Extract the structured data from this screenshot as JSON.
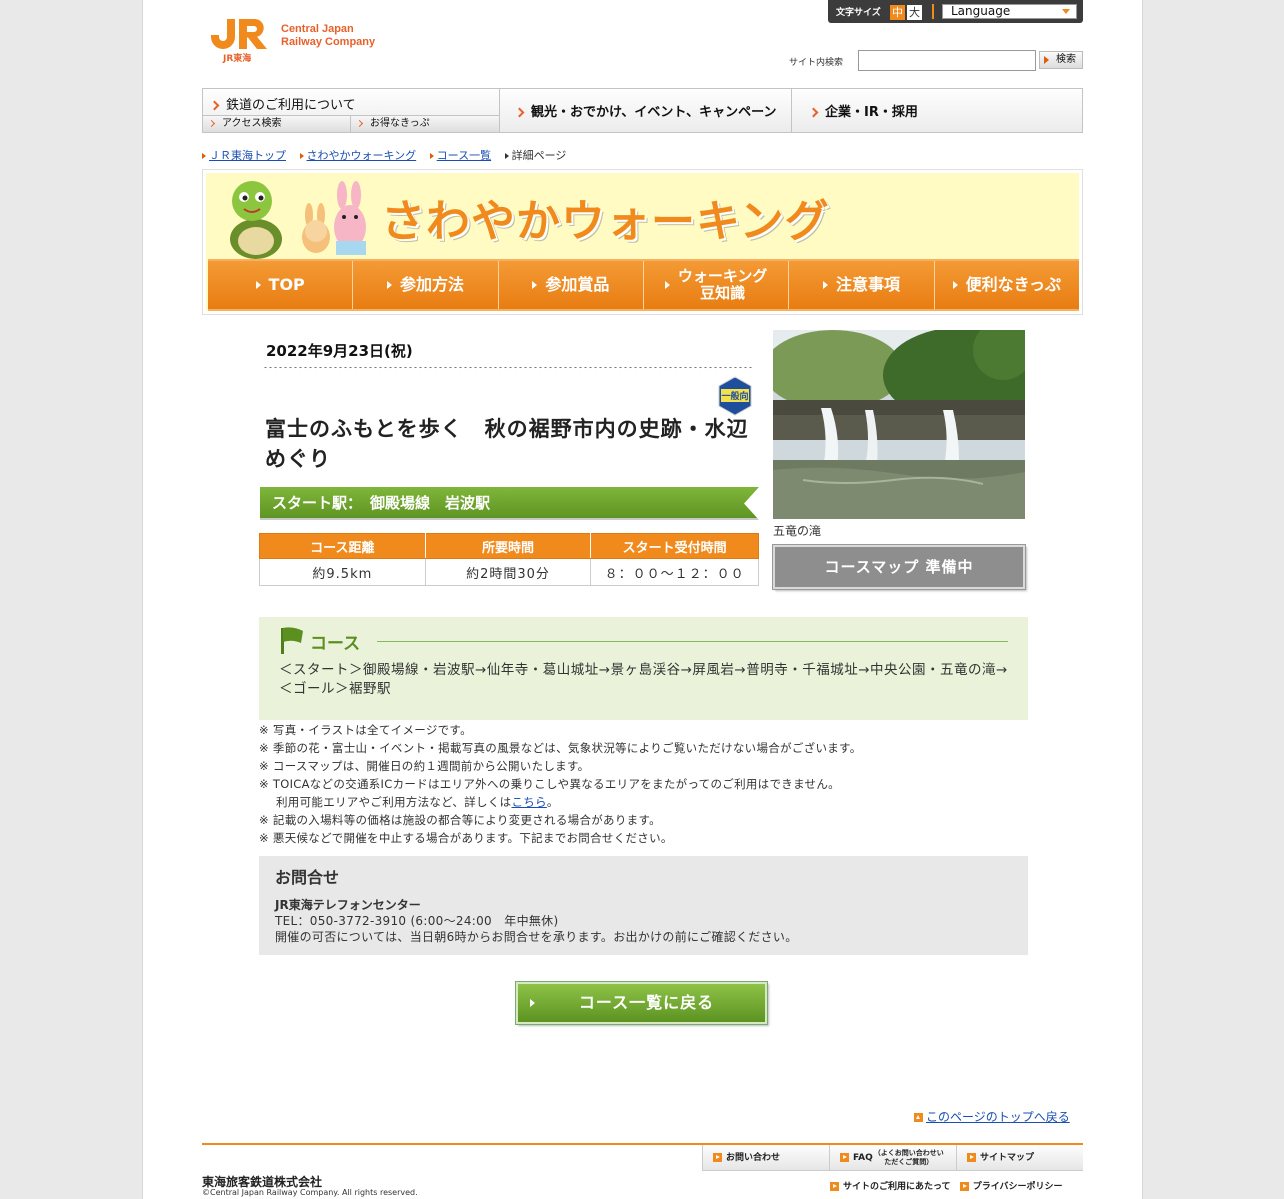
{
  "header": {
    "logo_text_line1": "Central Japan",
    "logo_text_line2": "Railway Company",
    "logo_sub": "JR東海",
    "fontsize_label": "文字サイズ",
    "fontsize_mid": "中",
    "fontsize_big": "大",
    "language": "Language",
    "search_label": "サイト内検索",
    "search_value": "",
    "search_button": "検索"
  },
  "gnav": {
    "rail": "鉄道のご利用について",
    "rail_sub1": "アクセス検索",
    "rail_sub2": "お得なきっぷ",
    "kanko": "観光・おでかけ、イベント、キャンペーン",
    "corp": "企業・IR・採用"
  },
  "breadcrumb": {
    "items": [
      "ＪＲ東海トップ",
      "さわやかウォーキング",
      "コース一覧"
    ],
    "current": "詳細ページ"
  },
  "banner": {
    "title": "さわやかウォーキング",
    "nav": [
      "TOP",
      "参加方法",
      "参加賞品",
      "ウォーキング",
      "豆知識",
      "注意事項",
      "便利なきっぷ"
    ]
  },
  "event": {
    "date": "2022年9月23日(祝)",
    "level": "一般向",
    "title": "富士のふもとを歩く　秋の裾野市内の史跡・水辺めぐり",
    "start_label": "スタート駅：",
    "start_station": "御殿場線　岩波駅",
    "table_headers": [
      "コース距離",
      "所要時間",
      "スタート受付時間"
    ],
    "table_values": [
      "約9.5km",
      "約2時間30分",
      "８：００～１２：００"
    ],
    "photo_caption": "五竜の滝",
    "map_button": "コースマップ 準備中"
  },
  "course": {
    "heading": "コース",
    "route": "＜スタート＞御殿場線・岩波駅→仙年寺・葛山城址→景ヶ島渓谷→屏風岩→普明寺・千福城址→中央公園・五竜の滝→＜ゴール＞裾野駅"
  },
  "notes": {
    "n1": "※ 写真・イラストは全てイメージです。",
    "n2": "※ 季節の花・富士山・イベント・掲載写真の風景などは、気象状況等によりご覧いただけない場合がございます。",
    "n3": "※ コースマップは、開催日の約１週間前から公開いたします。",
    "n4a": "※ TOICAなどの交通系ICカードはエリア外への乗りこしや異なるエリアをまたがってのご利用はできません。",
    "n4b": "利用可能エリアやご利用方法など、詳しくは",
    "n4link": "こちら",
    "n4c": "。",
    "n5": "※ 記載の入場料等の価格は施設の都合等により変更される場合があります。",
    "n6": "※ 悪天候などで開催を中止する場合があります。下記までお問合せください。"
  },
  "contact": {
    "heading": "お問合せ",
    "name": "JR東海テレフォンセンター",
    "tel": "TEL：050-3772-3910 (6:00～24:00　年中無休)",
    "note": "開催の可否については、当日朝6時からお問合せを承ります。お出かけの前にご確認ください。"
  },
  "back_button": "コース一覧に戻る",
  "page_top": "このページのトップへ戻る",
  "footer": {
    "nav": [
      "お問い合わせ",
      "FAQ",
      "（よくお問い合わせいただくご質問）",
      "サイトマップ"
    ],
    "links": [
      "サイトのご利用にあたって",
      "プライバシーポリシー"
    ],
    "company": "東海旅客鉄道株式会社",
    "copyright": "©Central Japan Railway Company.  All rights reserved."
  }
}
